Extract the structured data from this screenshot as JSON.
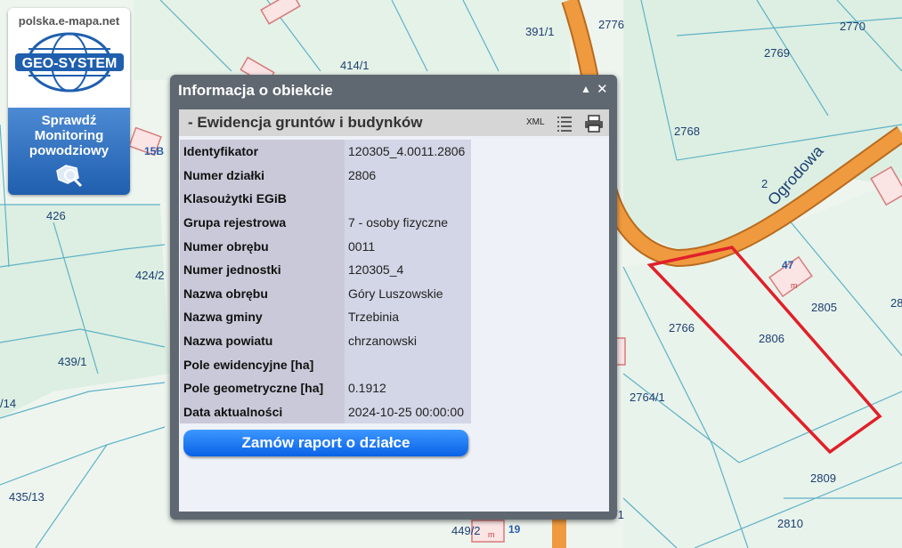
{
  "map": {
    "parcels": [
      "391/1",
      "414/1",
      "2776",
      "2770",
      "2769",
      "2768",
      "2766",
      "2806",
      "2805",
      "2764/1",
      "2809",
      "2810",
      "426",
      "424/2",
      "439/1",
      "435/13",
      "449/2",
      "/14",
      "2",
      "28",
      "/1"
    ],
    "street_name": "Ogrodowa",
    "building_numbers": [
      "15B",
      "47",
      "19"
    ],
    "building_letter": "m",
    "colors": {
      "road": "#f09a3f",
      "land": "#dff0e4",
      "water": "#eef5ef",
      "parcel_line": "#5fb2c6",
      "selection": "#e0202a"
    }
  },
  "logo": {
    "site": "polska.e-mapa.net",
    "brand": "GEO-SYSTEM",
    "promo_lines": [
      "Sprawdź",
      "Monitoring",
      "powodziowy"
    ],
    "icon": "magnifier-map-icon"
  },
  "dialog": {
    "title": "Informacja o obiekcie",
    "collapse_icon": "▲",
    "close_icon": "✕",
    "section": {
      "title": "-   Ewidencja gruntów i budynków",
      "xml_label": "XML",
      "list_icon": "list-icon",
      "print_icon": "printer-icon"
    },
    "rows": [
      {
        "key": "Identyfikator",
        "value": "120305_4.0011.2806"
      },
      {
        "key": "Numer działki",
        "value": "2806"
      },
      {
        "key": "Klasoużytki EGiB",
        "value": ""
      },
      {
        "key": "Grupa rejestrowa",
        "value": "7 - osoby fizyczne"
      },
      {
        "key": "Numer obrębu",
        "value": "0011"
      },
      {
        "key": "Numer jednostki",
        "value": "120305_4"
      },
      {
        "key": "Nazwa obrębu",
        "value": "Góry Luszowskie"
      },
      {
        "key": "Nazwa gminy",
        "value": "Trzebinia"
      },
      {
        "key": "Nazwa powiatu",
        "value": "chrzanowski"
      },
      {
        "key": "Pole ewidencyjne [ha]",
        "value": ""
      },
      {
        "key": "Pole geometryczne [ha]",
        "value": "0.1912"
      },
      {
        "key": "Data aktualności",
        "value": "2024-10-25 00:00:00"
      }
    ],
    "report_button": "Zamów raport o działce"
  }
}
